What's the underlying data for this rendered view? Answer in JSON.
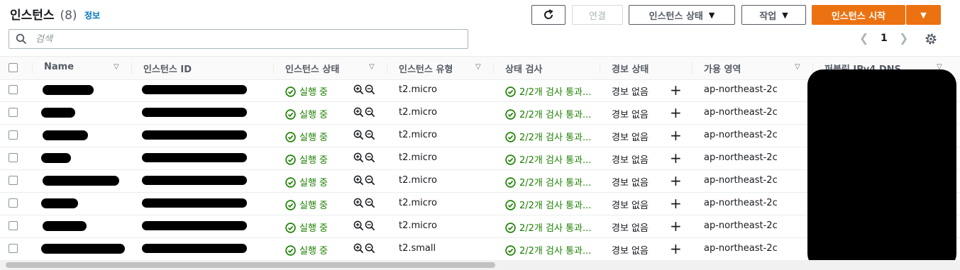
{
  "header": {
    "title": "인스턴스",
    "count": "(8)",
    "info": "정보",
    "buttons": {
      "refresh_icon": "refresh-icon",
      "connect": "연결",
      "instance_state": "인스턴스 상태",
      "actions": "작업",
      "launch": "인스턴스 시작"
    }
  },
  "search": {
    "placeholder": "검색"
  },
  "pagination": {
    "page": "1"
  },
  "table": {
    "columns": [
      "Name",
      "인스턴스 ID",
      "인스턴스 상태",
      "인스턴스 유형",
      "상태 검사",
      "경보 상태",
      "가용 영역",
      "퍼블릭 IPv4 DNS"
    ],
    "rows": [
      {
        "state": "실행 중",
        "type": "t2.micro",
        "check": "2/2개 검사 통과...",
        "alarm": "경보 없음",
        "az": "ap-northeast-2c"
      },
      {
        "state": "실행 중",
        "type": "t2.micro",
        "check": "2/2개 검사 통과...",
        "alarm": "경보 없음",
        "az": "ap-northeast-2c"
      },
      {
        "state": "실행 중",
        "type": "t2.micro",
        "check": "2/2개 검사 통과...",
        "alarm": "경보 없음",
        "az": "ap-northeast-2c"
      },
      {
        "state": "실행 중",
        "type": "t2.micro",
        "check": "2/2개 검사 통과...",
        "alarm": "경보 없음",
        "az": "ap-northeast-2c"
      },
      {
        "state": "실행 중",
        "type": "t2.micro",
        "check": "2/2개 검사 통과...",
        "alarm": "경보 없음",
        "az": "ap-northeast-2c"
      },
      {
        "state": "실행 중",
        "type": "t2.micro",
        "check": "2/2개 검사 통과...",
        "alarm": "경보 없음",
        "az": "ap-northeast-2c"
      },
      {
        "state": "실행 중",
        "type": "t2.micro",
        "check": "2/2개 검사 통과...",
        "alarm": "경보 없음",
        "az": "ap-northeast-2c"
      },
      {
        "state": "실행 중",
        "type": "t2.small",
        "check": "2/2개 검사 통과...",
        "alarm": "경보 없음",
        "az": "ap-northeast-2c"
      }
    ]
  },
  "colors": {
    "primary": "#ec7211",
    "link": "#0073bb",
    "success": "#1d8102"
  }
}
